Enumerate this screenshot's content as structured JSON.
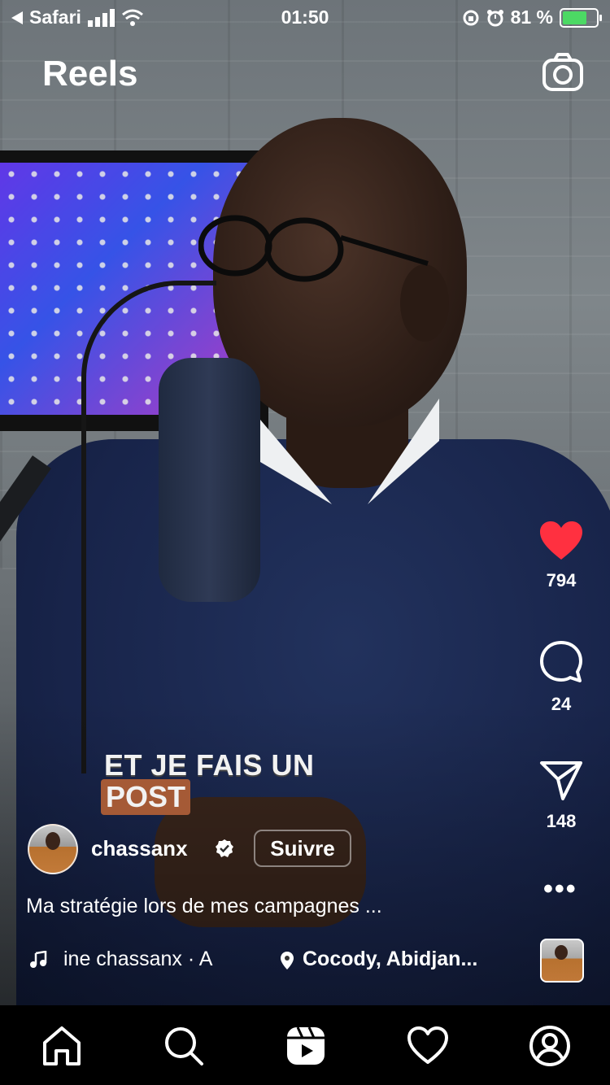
{
  "status_bar": {
    "back_app": "Safari",
    "time": "01:50",
    "battery_percent": "81 %",
    "battery_level": 0.81,
    "charging": true
  },
  "header": {
    "title": "Reels",
    "camera_icon": "camera-icon"
  },
  "video": {
    "overlay_text_line1": "ET JE FAIS UN",
    "overlay_text_line2": "POST"
  },
  "actions": {
    "like": {
      "icon": "heart-filled-icon",
      "count": "794",
      "color": "#ff3040"
    },
    "comment": {
      "icon": "comment-icon",
      "count": "24"
    },
    "share": {
      "icon": "send-icon",
      "count": "148"
    },
    "more": {
      "icon": "more-horizontal-icon",
      "label": "•••"
    }
  },
  "post": {
    "username": "chassanx",
    "verified": true,
    "follow_label": "Suivre",
    "caption": "Ma stratégie lors de mes campagnes ...",
    "audio_text": "ine   chassanx · A",
    "location": "Cocody, Abidjan..."
  },
  "nav": {
    "items": [
      "home-icon",
      "search-icon",
      "reels-icon",
      "heart-icon",
      "profile-icon"
    ],
    "active": "reels-icon"
  }
}
